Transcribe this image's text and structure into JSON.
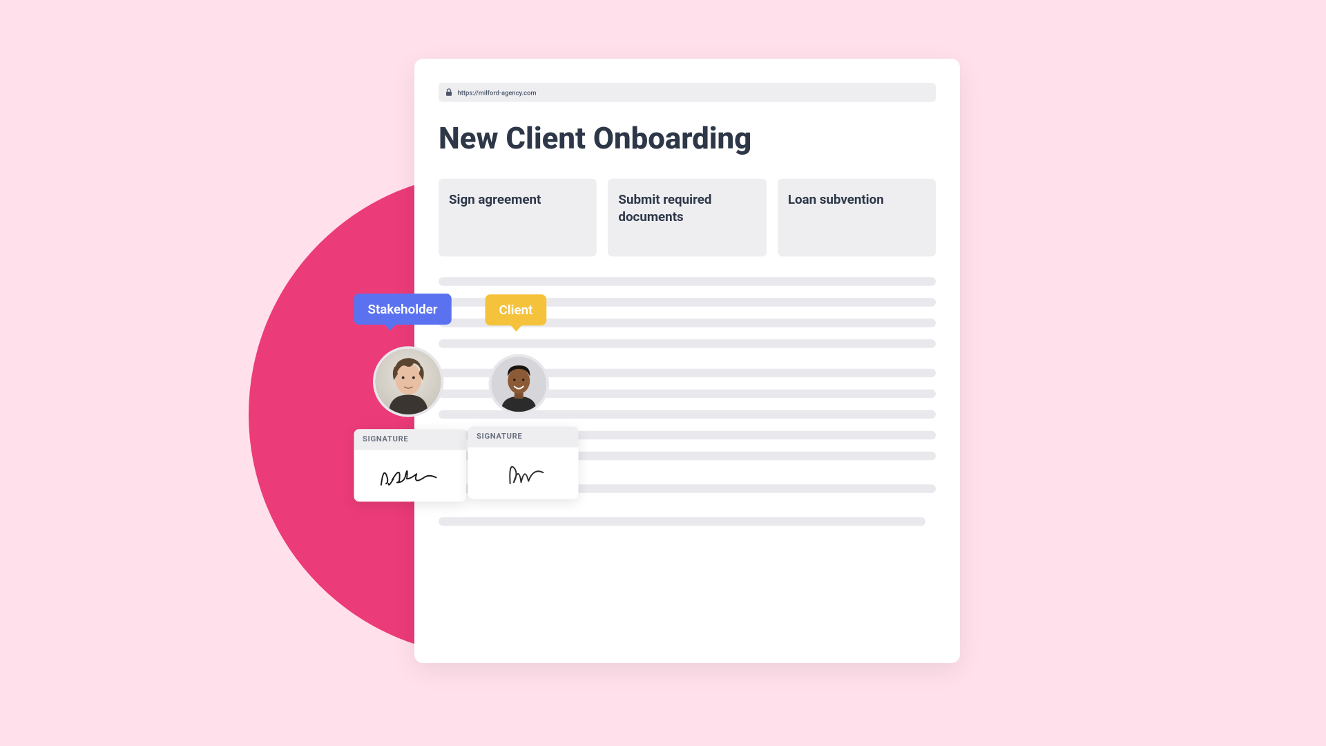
{
  "browser": {
    "url": "https://milford-agency.com"
  },
  "page": {
    "title": "New Client Onboarding"
  },
  "steps": [
    {
      "label": "Sign agreement"
    },
    {
      "label": "Submit required documents"
    },
    {
      "label": "Loan subvention"
    }
  ],
  "participants": {
    "stakeholder": {
      "role_label": "Stakeholder",
      "signature_label": "SIGNATURE"
    },
    "client": {
      "role_label": "Client",
      "signature_label": "SIGNATURE"
    }
  },
  "colors": {
    "background": "#FFE0EB",
    "accent_circle": "#EB3B79",
    "stakeholder_badge": "#5B72F0",
    "client_badge": "#F5C23B"
  }
}
